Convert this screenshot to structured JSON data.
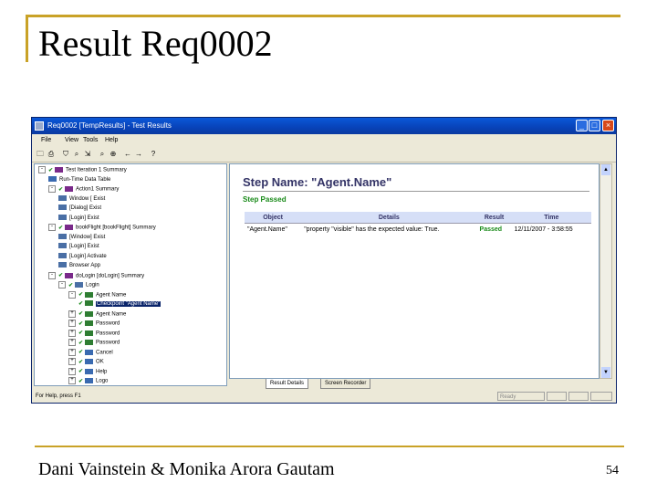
{
  "slide": {
    "title": "Result Req0002",
    "author": "Dani Vainstein & Monika Arora Gautam",
    "page_number": "54",
    "frame_color": "#c9a227"
  },
  "window": {
    "title": "Req0002 [TempResults] - Test Results",
    "menu": [
      "File",
      "View",
      "Tools",
      "Help"
    ],
    "toolbar_icons": [
      "open-icon",
      "print-icon",
      "filter-icon",
      "find-icon",
      "jump-icon",
      "search-icon",
      "zoom-icon",
      "back-icon",
      "forward-icon",
      "help-icon"
    ],
    "min_glyph": "_",
    "max_glyph": "□",
    "close_glyph": "×"
  },
  "tree": [
    {
      "label": "Test Iteration 1 Summary",
      "level": 0,
      "expander": "-",
      "check": true,
      "icon": "iteration"
    },
    {
      "label": "Run-Time Data Table",
      "level": 1,
      "expander": "",
      "check": false,
      "icon": "table"
    },
    {
      "label": "Action1 Summary",
      "level": 1,
      "expander": "-",
      "check": true,
      "icon": "action"
    },
    {
      "label": "Window [ Exist",
      "level": 2,
      "expander": "",
      "check": false,
      "icon": "window"
    },
    {
      "label": "[Dialog] Exist",
      "level": 2,
      "expander": "",
      "check": false,
      "icon": "window"
    },
    {
      "label": "[Login] Exist",
      "level": 2,
      "expander": "",
      "check": false,
      "icon": "window"
    },
    {
      "label": "bookFlight [bookFlight] Summary",
      "level": 1,
      "expander": "-",
      "check": true,
      "icon": "action"
    },
    {
      "label": "[Window] Exist",
      "level": 2,
      "expander": "",
      "check": false,
      "icon": "window"
    },
    {
      "label": "[Login] Exist",
      "level": 2,
      "expander": "",
      "check": false,
      "icon": "window"
    },
    {
      "label": "[Login] Activate",
      "level": 2,
      "expander": "",
      "check": false,
      "icon": "window"
    },
    {
      "label": "Browser App",
      "level": 2,
      "expander": "",
      "check": false,
      "icon": "window"
    },
    {
      "label": "doLogin [doLogin] Summary",
      "level": 1,
      "expander": "-",
      "check": true,
      "icon": "action"
    },
    {
      "label": "Login",
      "level": 2,
      "expander": "-",
      "check": true,
      "icon": "window"
    },
    {
      "label": "Agent Name",
      "level": 3,
      "expander": "-",
      "check": true,
      "icon": "field"
    },
    {
      "label": "Checkpoint \"Agent Name\"",
      "level": 4,
      "expander": "",
      "check": true,
      "icon": "checkpoint",
      "selected": true
    },
    {
      "label": "Agent Name",
      "level": 3,
      "expander": "+",
      "check": true,
      "icon": "field"
    },
    {
      "label": "Password",
      "level": 3,
      "expander": "+",
      "check": true,
      "icon": "field"
    },
    {
      "label": "Password",
      "level": 3,
      "expander": "+",
      "check": true,
      "icon": "field"
    },
    {
      "label": "Password",
      "level": 3,
      "expander": "+",
      "check": true,
      "icon": "field"
    },
    {
      "label": "Cancel",
      "level": 3,
      "expander": "+",
      "check": true,
      "icon": "button"
    },
    {
      "label": "OK",
      "level": 3,
      "expander": "+",
      "check": true,
      "icon": "button"
    },
    {
      "label": "Help",
      "level": 3,
      "expander": "+",
      "check": true,
      "icon": "button"
    },
    {
      "label": "Logo",
      "level": 3,
      "expander": "+",
      "check": true,
      "icon": "button"
    }
  ],
  "detail": {
    "step_name": "Step Name: \"Agent.Name\"",
    "step_status": "Step Passed",
    "columns": [
      "Object",
      "Details",
      "Result",
      "Time"
    ],
    "rows": [
      [
        "\"Agent.Name\"",
        "\"property \"visible\" has the expected value: True.",
        "Passed",
        "12/11/2007 - 3:58:55"
      ]
    ]
  },
  "tabs": [
    "Result Details",
    "Screen Recorder"
  ],
  "status": {
    "message": "For Help, press F1",
    "ready": "Ready"
  },
  "colors": {
    "passed": "#188a18",
    "header": "#333366",
    "titlebar": "#0a58d8"
  }
}
